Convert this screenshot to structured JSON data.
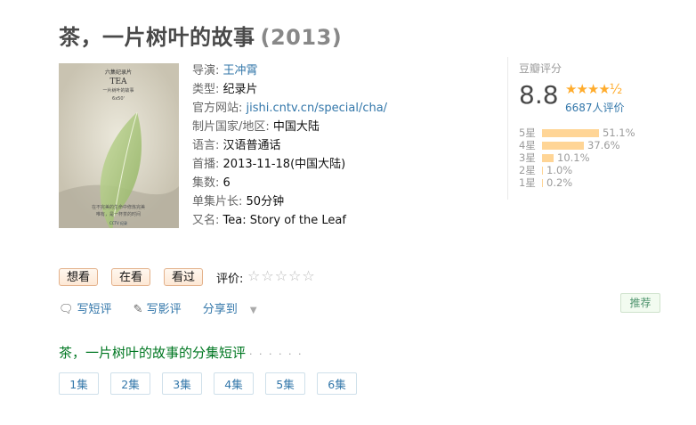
{
  "title": "茶，一片树叶的故事",
  "year": "(2013)",
  "poster": {
    "subtitle_cn": "六集纪录片",
    "tea": "TEA",
    "caption": "一片树叶的故事",
    "duration": "6x50'",
    "tagline1": "在不完美的生命中修炼完美",
    "tagline2": "唯有，是一杯茶的时间",
    "logo": "CCTV 纪录"
  },
  "info": {
    "director_label": "导演:",
    "director": "王冲霄",
    "type_label": "类型:",
    "type": "纪录片",
    "site_label": "官方网站:",
    "site": "jishi.cntv.cn/special/cha/",
    "country_label": "制片国家/地区:",
    "country": "中国大陆",
    "lang_label": "语言:",
    "lang": "汉语普通话",
    "premiere_label": "首播:",
    "premiere": "2013-11-18(中国大陆)",
    "episodes_label": "集数:",
    "episodes": "6",
    "runtime_label": "单集片长:",
    "runtime": "50分钟",
    "aka_label": "又名:",
    "aka": "Tea: Story of the Leaf"
  },
  "rating": {
    "title": "豆瓣评分",
    "score": "8.8",
    "stars": "★★★★½",
    "votes": "6687人评价",
    "dist": [
      {
        "label": "5星",
        "pct_text": "51.1%",
        "pct": 51.1
      },
      {
        "label": "4星",
        "pct_text": "37.6%",
        "pct": 37.6
      },
      {
        "label": "3星",
        "pct_text": "10.1%",
        "pct": 10.1
      },
      {
        "label": "2星",
        "pct_text": "1.0%",
        "pct": 1.0
      },
      {
        "label": "1星",
        "pct_text": "0.2%",
        "pct": 0.2
      }
    ]
  },
  "buttons": {
    "want": "想看",
    "watching": "在看",
    "watched": "看过",
    "rate_label": "评价:",
    "rate_stars": "☆☆☆☆☆"
  },
  "actions": {
    "short_review": "写短评",
    "review": "写影评",
    "share": "分享到",
    "recommend": "推荐"
  },
  "section": {
    "title": "茶，一片树叶的故事的分集短评",
    "dots": "· · · · · ·",
    "episodes": [
      "1集",
      "2集",
      "3集",
      "4集",
      "5集",
      "6集"
    ]
  },
  "colors": {
    "link": "#3377aa",
    "green": "#007722",
    "star": "#ffac2d",
    "bar": "#ffd596"
  }
}
